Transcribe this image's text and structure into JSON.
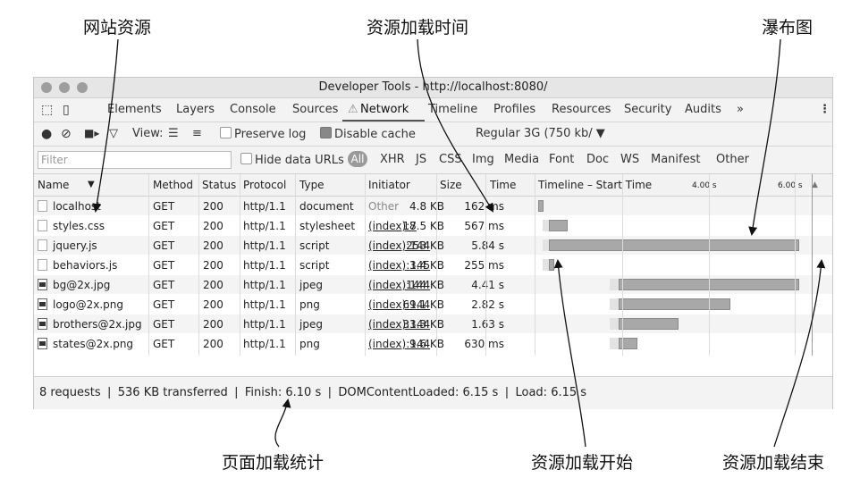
{
  "annotations": {
    "website_resources": "网站资源",
    "load_time": "资源加载时间",
    "waterfall": "瀑布图",
    "page_stats": "页面加载统计",
    "load_start": "资源加载开始",
    "load_end": "资源加载结束"
  },
  "window": {
    "title": "Developer Tools - http://localhost:8080/"
  },
  "tabs": [
    "Elements",
    "Layers",
    "Console",
    "Sources",
    "Network",
    "Timeline",
    "Profiles",
    "Resources",
    "Security",
    "Audits"
  ],
  "active_tab": "Network",
  "more_tabs": "»",
  "menu": "⋮",
  "toolbar": {
    "view_label": "View:",
    "preserve_log": "Preserve log",
    "disable_cache": "Disable cache",
    "throttle": "Regular 3G (750 kb/ ▼"
  },
  "filter": {
    "placeholder": "Filter",
    "hide_data_urls": "Hide data URLs",
    "all": "All",
    "types": [
      "XHR",
      "JS",
      "CSS",
      "Img",
      "Media",
      "Font",
      "Doc",
      "WS",
      "Manifest",
      "Other"
    ]
  },
  "table": {
    "headers": [
      "Name",
      "Method",
      "Status",
      "Protocol",
      "Type",
      "Initiator",
      "Size",
      "Time",
      "Timeline – Start Time"
    ],
    "tick_labels": [
      "4.00 s",
      "6.00 s"
    ],
    "rows": [
      {
        "name": "localhost",
        "method": "GET",
        "status": "200",
        "protocol": "http/1.1",
        "type": "document",
        "initiator": "Other",
        "size": "4.8 KB",
        "time": "162 ms",
        "icon": "doc"
      },
      {
        "name": "styles.css",
        "method": "GET",
        "status": "200",
        "protocol": "http/1.1",
        "type": "stylesheet",
        "initiator": "(index):7",
        "size": "18.5 KB",
        "time": "567 ms",
        "icon": "doc"
      },
      {
        "name": "jquery.js",
        "method": "GET",
        "status": "200",
        "protocol": "http/1.1",
        "type": "script",
        "initiator": "(index):144",
        "size": "253 KB",
        "time": "5.84 s",
        "icon": "doc"
      },
      {
        "name": "behaviors.js",
        "method": "GET",
        "status": "200",
        "protocol": "http/1.1",
        "type": "script",
        "initiator": "(index):145",
        "size": "3.4 KB",
        "time": "255 ms",
        "icon": "doc"
      },
      {
        "name": "bg@2x.jpg",
        "method": "GET",
        "status": "200",
        "protocol": "http/1.1",
        "type": "jpeg",
        "initiator": "(index):144",
        "size": "144 KB",
        "time": "4.41 s",
        "icon": "img"
      },
      {
        "name": "logo@2x.png",
        "method": "GET",
        "status": "200",
        "protocol": "http/1.1",
        "type": "png",
        "initiator": "(index):144",
        "size": "69.1 KB",
        "time": "2.82 s",
        "icon": "img"
      },
      {
        "name": "brothers@2x.jpg",
        "method": "GET",
        "status": "200",
        "protocol": "http/1.1",
        "type": "jpeg",
        "initiator": "(index):144",
        "size": "33.3 KB",
        "time": "1.63 s",
        "icon": "img"
      },
      {
        "name": "states@2x.png",
        "method": "GET",
        "status": "200",
        "protocol": "http/1.1",
        "type": "png",
        "initiator": "(index):144",
        "size": "9.6 KB",
        "time": "630 ms",
        "icon": "img"
      }
    ]
  },
  "timeline": {
    "max_seconds": 6.6,
    "ticks": [
      2,
      4,
      6
    ],
    "rows": [
      {
        "start": 0.05,
        "download_start": 0.05,
        "end": 0.16
      },
      {
        "start": 0.15,
        "download_start": 0.3,
        "end": 0.72
      },
      {
        "start": 0.15,
        "download_start": 0.3,
        "end": 6.1
      },
      {
        "start": 0.15,
        "download_start": 0.3,
        "end": 0.42
      },
      {
        "start": 1.7,
        "download_start": 1.9,
        "end": 6.1
      },
      {
        "start": 1.7,
        "download_start": 1.9,
        "end": 4.5
      },
      {
        "start": 1.7,
        "download_start": 1.9,
        "end": 3.3
      },
      {
        "start": 1.7,
        "download_start": 1.9,
        "end": 2.35
      }
    ]
  },
  "status": "8 requests ❘ 536 KB transferred ❘ Finish: 6.10 s ❘ DOMContentLoaded: 6.15 s ❘ Load: 6.15 s"
}
